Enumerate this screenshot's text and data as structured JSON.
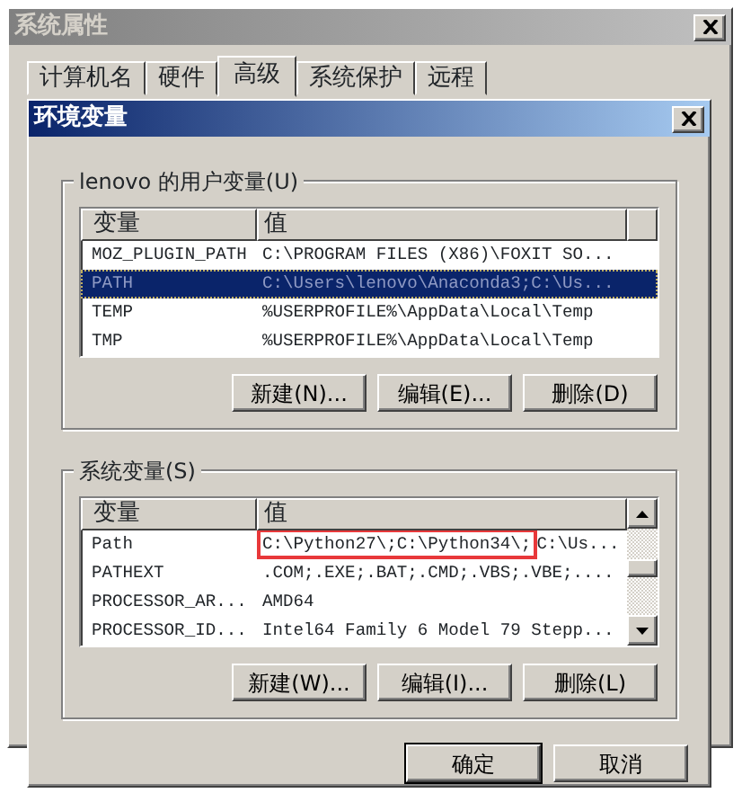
{
  "outer_window": {
    "title": "系统属性"
  },
  "tabs": [
    {
      "label": "计算机名",
      "selected": false
    },
    {
      "label": "硬件",
      "selected": false
    },
    {
      "label": "高级",
      "selected": true
    },
    {
      "label": "系统保护",
      "selected": false
    },
    {
      "label": "远程",
      "selected": false
    }
  ],
  "dialog": {
    "title": "环境变量"
  },
  "groups": [
    {
      "label": "lenovo 的用户变量(U)",
      "scrollbar": false,
      "columns": [
        "变量",
        "值"
      ],
      "rows": [
        {
          "name": "MOZ_PLUGIN_PATH",
          "value": "C:\\PROGRAM FILES (X86)\\FOXIT SO...",
          "selected": false
        },
        {
          "name": "PATH",
          "value": "C:\\Users\\lenovo\\Anaconda3;C:\\Us...",
          "selected": true
        },
        {
          "name": "TEMP",
          "value": "%USERPROFILE%\\AppData\\Local\\Temp",
          "selected": false
        },
        {
          "name": "TMP",
          "value": "%USERPROFILE%\\AppData\\Local\\Temp",
          "selected": false
        }
      ],
      "buttons": [
        "新建(N)...",
        "编辑(E)...",
        "删除(D)"
      ]
    },
    {
      "label": "系统变量(S)",
      "scrollbar": true,
      "columns": [
        "变量",
        "值"
      ],
      "rows": [
        {
          "name": "Path",
          "boxed": "C:\\Python27\\;C:\\Python34\\;",
          "value": "C:\\Us...",
          "selected": false
        },
        {
          "name": "PATHEXT",
          "value": ".COM;.EXE;.BAT;.CMD;.VBS;.VBE;....",
          "selected": false
        },
        {
          "name": "PROCESSOR_AR...",
          "value": "AMD64",
          "selected": false
        },
        {
          "name": "PROCESSOR_ID...",
          "value": "Intel64 Family 6 Model 79 Stepp...",
          "selected": false
        }
      ],
      "buttons": [
        "新建(W)...",
        "编辑(I)...",
        "删除(L)"
      ]
    }
  ],
  "footer_buttons": [
    {
      "label": "确定",
      "default": true
    },
    {
      "label": "取消",
      "default": false
    }
  ]
}
